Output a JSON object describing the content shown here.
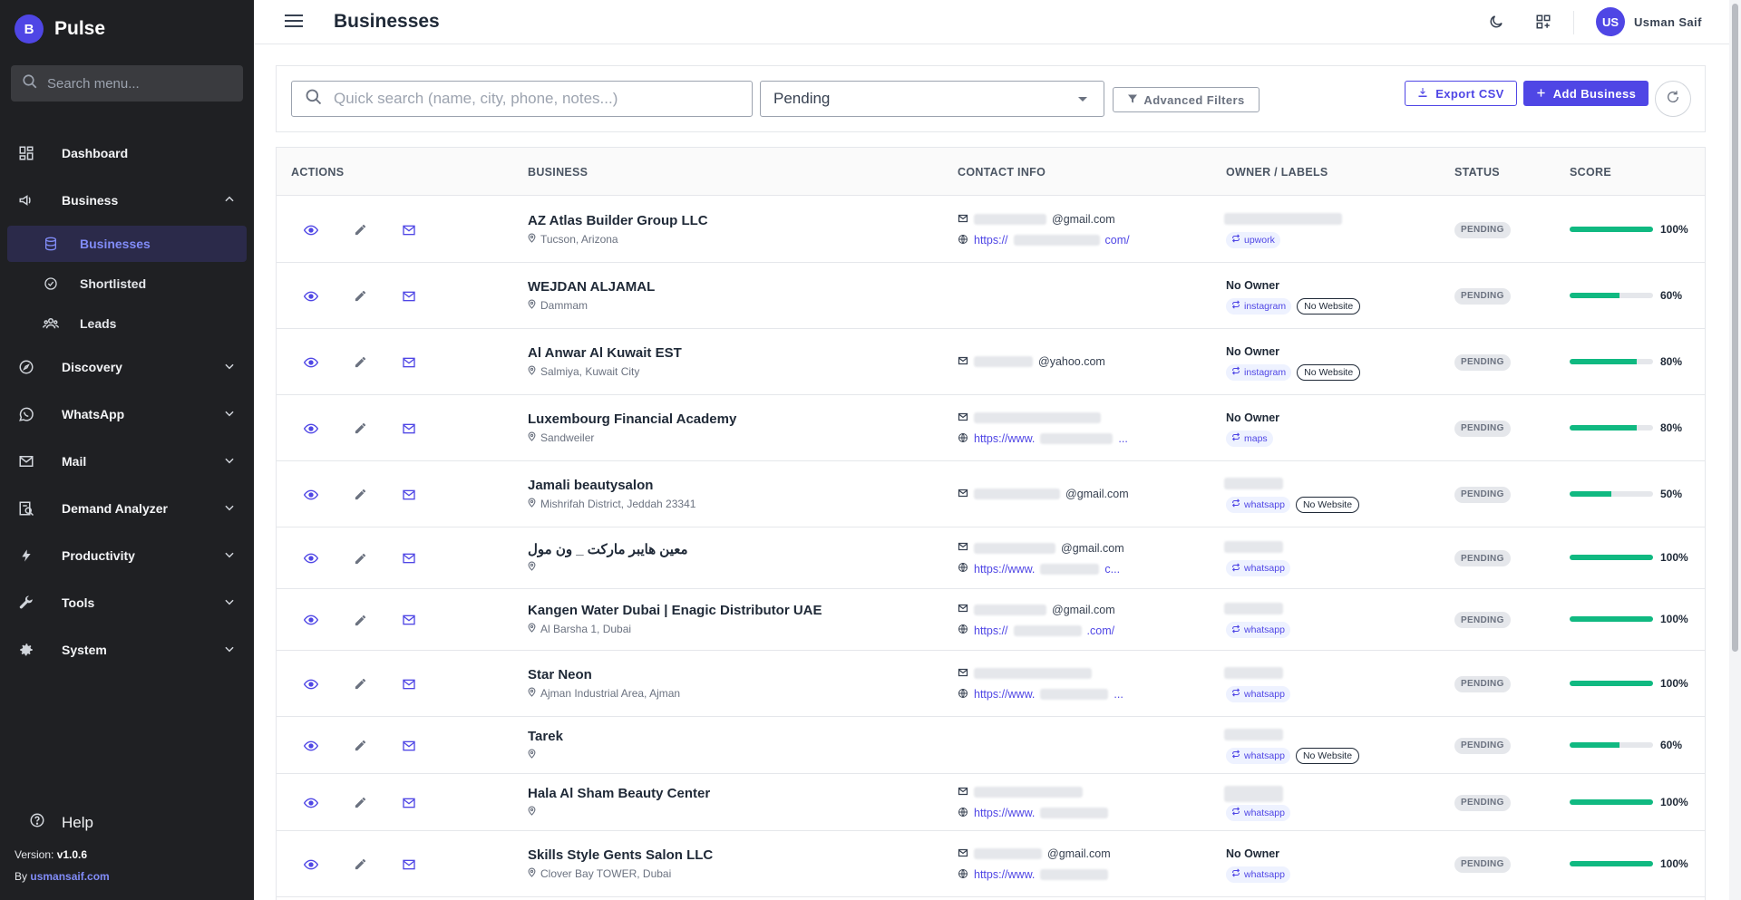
{
  "brand": {
    "logo_letter": "B",
    "name": "Pulse"
  },
  "sidebar": {
    "search_placeholder": "Search menu...",
    "items": [
      {
        "label": "Dashboard",
        "icon": "grid-icon"
      },
      {
        "label": "Business",
        "icon": "megaphone-icon",
        "expanded": true
      },
      {
        "label": "Discovery",
        "icon": "compass-icon"
      },
      {
        "label": "WhatsApp",
        "icon": "whatsapp-icon"
      },
      {
        "label": "Mail",
        "icon": "mail-icon"
      },
      {
        "label": "Demand Analyzer",
        "icon": "analyzer-icon"
      },
      {
        "label": "Productivity",
        "icon": "lightning-icon"
      },
      {
        "label": "Tools",
        "icon": "wrench-icon"
      },
      {
        "label": "System",
        "icon": "gear-icon"
      }
    ],
    "business_sub": [
      {
        "label": "Businesses",
        "icon": "database-icon",
        "active": true
      },
      {
        "label": "Shortlisted",
        "icon": "check-circle-icon"
      },
      {
        "label": "Leads",
        "icon": "people-icon"
      }
    ],
    "help_label": "Help",
    "version_prefix": "Version:",
    "version": "v1.0.6",
    "by_prefix": "By",
    "by_link": "usmansaif.com"
  },
  "header": {
    "title": "Businesses",
    "user_initials": "US",
    "user_name": "Usman Saif"
  },
  "filters": {
    "search_placeholder": "Quick search (name, city, phone, notes...)",
    "status_value": "Pending",
    "advanced_label": "Advanced Filters",
    "export_label": "Export CSV",
    "add_label": "Add Business"
  },
  "table": {
    "headers": [
      "ACTIONS",
      "BUSINESS",
      "CONTACT INFO",
      "OWNER / LABELS",
      "STATUS",
      "SCORE"
    ],
    "rows": [
      {
        "name": "AZ Atlas Builder Group LLC",
        "location": "Tucson, Arizona",
        "email": "@gmail.com",
        "url_prefix": "https://",
        "url_suffix": "com/",
        "owner": "",
        "sources": [
          "upwork"
        ],
        "no_website": false,
        "status": "PENDING",
        "score": 100,
        "score_label": "100%"
      },
      {
        "name": "WEJDAN ALJAMAL",
        "location": "Dammam",
        "email": null,
        "url_prefix": null,
        "url_suffix": null,
        "owner": "No Owner",
        "sources": [
          "instagram"
        ],
        "no_website": true,
        "status": "PENDING",
        "score": 60,
        "score_label": "60%"
      },
      {
        "name": "Al Anwar Al Kuwait EST",
        "location": "Salmiya, Kuwait City",
        "email": "@yahoo.com",
        "url_prefix": null,
        "url_suffix": null,
        "owner": "No Owner",
        "sources": [
          "instagram"
        ],
        "no_website": true,
        "status": "PENDING",
        "score": 80,
        "score_label": "80%"
      },
      {
        "name": "Luxembourg Financial Academy",
        "location": "Sandweiler",
        "email": "",
        "url_prefix": "https://www.",
        "url_suffix": "...",
        "owner": "No Owner",
        "sources": [
          "maps"
        ],
        "no_website": false,
        "status": "PENDING",
        "score": 80,
        "score_label": "80%"
      },
      {
        "name": "Jamali beautysalon",
        "location": "Mishrifah District, Jeddah 23341",
        "email": "@gmail.com",
        "url_prefix": null,
        "url_suffix": null,
        "owner": "",
        "sources": [
          "whatsapp"
        ],
        "no_website": true,
        "status": "PENDING",
        "score": 50,
        "score_label": "50%"
      },
      {
        "name": "معين هايبر ماركت _ ون مول",
        "location": "",
        "email": "@gmail.com",
        "url_prefix": "https://www.",
        "url_suffix": "c...",
        "owner": "",
        "sources": [
          "whatsapp"
        ],
        "no_website": false,
        "status": "PENDING",
        "score": 100,
        "score_label": "100%"
      },
      {
        "name": "Kangen Water Dubai | Enagic Distributor UAE",
        "location": "Al Barsha 1, Dubai",
        "email": "@gmail.com",
        "url_prefix": "https://",
        "url_suffix": ".com/",
        "owner": "",
        "sources": [
          "whatsapp"
        ],
        "no_website": false,
        "status": "PENDING",
        "score": 100,
        "score_label": "100%"
      },
      {
        "name": "Star Neon",
        "location": "Ajman Industrial Area, Ajman",
        "email": "",
        "url_prefix": "https://www.",
        "url_suffix": "...",
        "owner": "",
        "sources": [
          "whatsapp"
        ],
        "no_website": false,
        "status": "PENDING",
        "score": 100,
        "score_label": "100%"
      },
      {
        "name": "Tarek",
        "location": "",
        "email": null,
        "url_prefix": null,
        "url_suffix": null,
        "owner": "",
        "sources": [
          "whatsapp"
        ],
        "no_website": true,
        "status": "PENDING",
        "score": 60,
        "score_label": "60%"
      },
      {
        "name": "Hala Al Sham Beauty Center",
        "location": "",
        "email": "",
        "url_prefix": "https://www.",
        "url_suffix": "",
        "owner": "",
        "sources": [
          "whatsapp"
        ],
        "no_website": false,
        "status": "PENDING",
        "score": 100,
        "score_label": "100%"
      },
      {
        "name": "Skills Style Gents Salon LLC",
        "location": "Clover Bay TOWER, Dubai",
        "email": "@gmail.com",
        "url_prefix": "https://www.",
        "url_suffix": "",
        "owner": "No Owner",
        "sources": [
          "whatsapp"
        ],
        "no_website": false,
        "status": "PENDING",
        "score": 100,
        "score_label": "100%"
      }
    ],
    "no_website_label": "No Website"
  },
  "colors": {
    "accent": "#4f46e5",
    "sidebar_bg": "#1f2023",
    "score_fill": "#10b981",
    "active_text": "#818cf8"
  }
}
